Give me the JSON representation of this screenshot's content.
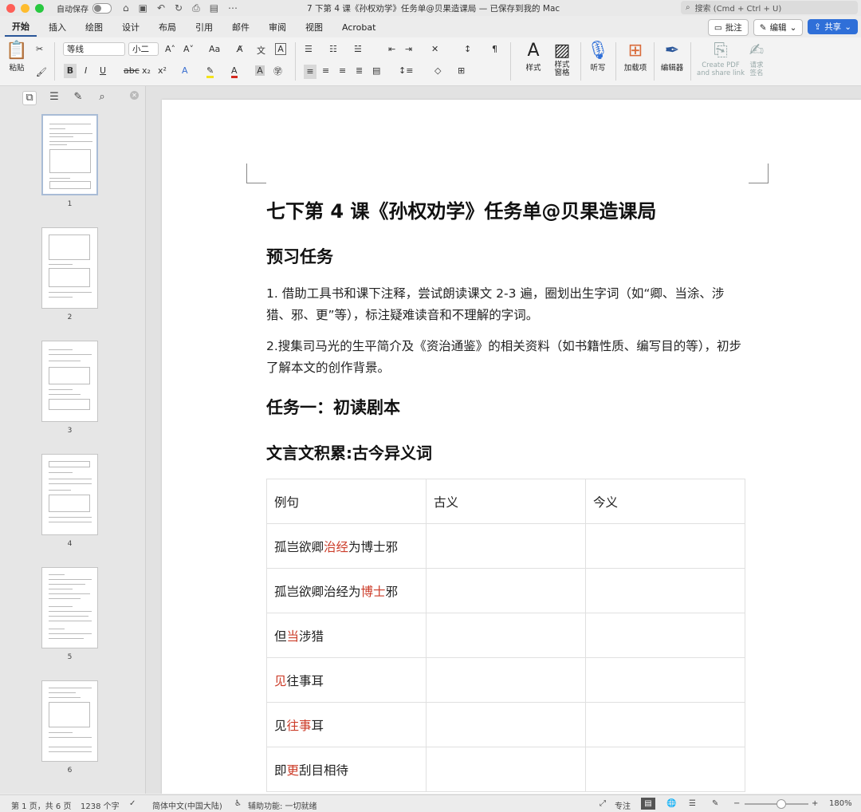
{
  "titlebar": {
    "autosave_label": "自动保存",
    "doc_title": "7 下第 4 课《孙权劝学》任务单@贝果造课局 — 已保存到我的 Mac",
    "search_placeholder": "搜索 (Cmd + Ctrl + U)"
  },
  "tabs": [
    "开始",
    "插入",
    "绘图",
    "设计",
    "布局",
    "引用",
    "邮件",
    "审阅",
    "视图",
    "Acrobat"
  ],
  "top_buttons": {
    "comment": "批注",
    "edit": "编辑",
    "share": "共享"
  },
  "ribbon": {
    "paste": "粘贴",
    "font_name": "等线",
    "font_size": "小二",
    "styles": "样式",
    "styles_pane": "样式\n窗格",
    "dictate": "听写",
    "addins": "加载项",
    "editor": "编辑器",
    "create_pdf": "Create PDF\nand share link",
    "request_sign": "请求\n签名"
  },
  "sidebar": {
    "pages": [
      "1",
      "2",
      "3",
      "4",
      "5",
      "6"
    ]
  },
  "document": {
    "title": "七下第 4 课《孙权劝学》任务单@贝果造课局",
    "section1": "预习任务",
    "p1": "1. 借助工具书和课下注释，尝试朗读课文 2-3 遍，圈划出生字词（如“卿、当涂、涉猎、邪、更”等），标注疑难读音和不理解的字词。",
    "p2": "2.搜集司马光的生平简介及《资治通鉴》的相关资料（如书籍性质、编写目的等），初步了解本文的创作背景。",
    "section2": "任务一：初读剧本",
    "section3": "文言文积累:古今异义词",
    "table": {
      "headers": [
        "例句",
        "古义",
        "今义"
      ],
      "rows": [
        {
          "pre": "孤岂欲卿",
          "hl": "治经",
          "post": "为博士邪"
        },
        {
          "pre": "孤岂欲卿治经为",
          "hl": "博士",
          "post": "邪"
        },
        {
          "pre": "但",
          "hl": "当",
          "post": "涉猎"
        },
        {
          "pre": "",
          "hl": "见",
          "post": "往事耳"
        },
        {
          "pre": "见",
          "hl": "往事",
          "post": "耳"
        },
        {
          "pre": "即",
          "hl": "更",
          "post": "刮目相待"
        }
      ]
    }
  },
  "statusbar": {
    "page": "第 1 页，共 6 页",
    "words": "1238 个字",
    "lang": "简体中文(中国大陆)",
    "access": "辅助功能: 一切就绪",
    "focus": "专注",
    "zoom": "180%"
  },
  "colors": {
    "accent": "#2b579a",
    "highlight": "#cc3d2a",
    "share": "#2f6fd8"
  }
}
